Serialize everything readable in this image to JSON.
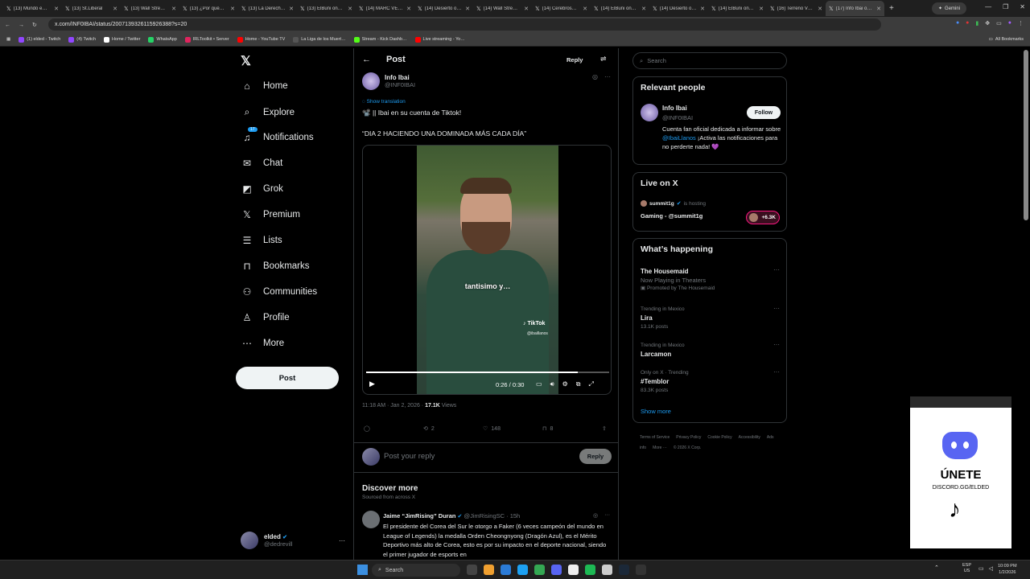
{
  "browser": {
    "tabs": [
      {
        "label": "(13) Mundo e…",
        "icon": "x-icon"
      },
      {
        "label": "(13) St.Liberal",
        "icon": "x-icon"
      },
      {
        "label": "(13) Wall Stre…",
        "icon": "x-icon"
      },
      {
        "label": "(13) ¿Por qué…",
        "icon": "x-icon"
      },
      {
        "label": "(13) La Derech…",
        "icon": "x-icon"
      },
      {
        "label": "(13) ElBuni on…",
        "icon": "x-icon"
      },
      {
        "label": "(14) MARC VE…",
        "icon": "x-icon"
      },
      {
        "label": "(14) Desierto o…",
        "icon": "x-icon"
      },
      {
        "label": "(14) Wall Stre…",
        "icon": "x-icon"
      },
      {
        "label": "(14) Cerebros…",
        "icon": "x-icon"
      },
      {
        "label": "(14) ElBuni on…",
        "icon": "x-icon"
      },
      {
        "label": "(14) Desierto o…",
        "icon": "x-icon"
      },
      {
        "label": "(14) ElBuni on…",
        "icon": "x-icon"
      },
      {
        "label": "(16) Terreno V…",
        "icon": "x-icon"
      },
      {
        "label": "(17) Info Ibai o…",
        "icon": "x-icon"
      }
    ],
    "new_tab": "+",
    "gemini": "Gemini",
    "url": "x.com/INF0IBAI/status/2007139326115926388?s=20",
    "bookmarks": [
      {
        "label": "(1) elded - Twitch",
        "color": "#9146ff"
      },
      {
        "label": "(4) Twitch",
        "color": "#9146ff"
      },
      {
        "label": "Home / Twitter",
        "color": "#ffffff"
      },
      {
        "label": "WhatsApp",
        "color": "#25d366"
      },
      {
        "label": "IRLToolkit • Server",
        "color": "#e0245e"
      },
      {
        "label": "Home - YouTube TV",
        "color": "#ff0000"
      },
      {
        "label": "La Liga de los Muert…",
        "color": "#555555"
      },
      {
        "label": "Stream - Kick Dashb…",
        "color": "#53fc18"
      },
      {
        "label": "Live streaming - Yo…",
        "color": "#ff0000"
      }
    ],
    "all_bookmarks": "All Bookmarks"
  },
  "nav": {
    "items": [
      {
        "label": "Home",
        "icon": "home-icon",
        "glyph": "⌂"
      },
      {
        "label": "Explore",
        "icon": "search-icon",
        "glyph": "⌕"
      },
      {
        "label": "Notifications",
        "icon": "bell-icon",
        "glyph": "♫"
      },
      {
        "label": "Chat",
        "icon": "envelope-icon",
        "glyph": "✉"
      },
      {
        "label": "Grok",
        "icon": "grok-icon",
        "glyph": "◩"
      },
      {
        "label": "Premium",
        "icon": "x-premium-icon",
        "glyph": "𝕏"
      },
      {
        "label": "Lists",
        "icon": "list-icon",
        "glyph": "☰"
      },
      {
        "label": "Bookmarks",
        "icon": "bookmark-icon",
        "glyph": "⊓"
      },
      {
        "label": "Communities",
        "icon": "communities-icon",
        "glyph": "⚇"
      },
      {
        "label": "Profile",
        "icon": "person-icon",
        "glyph": "♙"
      },
      {
        "label": "More",
        "icon": "more-circle-icon",
        "glyph": "⋯"
      }
    ],
    "notif_count": "17",
    "post_button": "Post",
    "user": {
      "name": "elded",
      "handle": "@dedrevill"
    }
  },
  "post": {
    "header_title": "Post",
    "header_reply": "Reply",
    "author_name": "Info Ibai",
    "author_handle": "@INF0IBAI",
    "show_translation": "Show translation",
    "line1": "📽️ || Ibai en su cuenta de Tiktok!",
    "line2": "“DIA 2 HACIENDO UNA DOMINADA MÁS CADA DÍA”",
    "video": {
      "caption": "tantisimo y…",
      "watermark": "TikTok",
      "watermark_handle": "@ibaillanos",
      "time": "0:26 / 0:30",
      "progress": 0.87
    },
    "timestamp": "11:18 AM · Jan 2, 2026 · ",
    "views_count": "17.1K",
    "views_label": " Views",
    "actions": {
      "reposts": "2",
      "likes": "148",
      "bookmarks": "8"
    },
    "reply_placeholder": "Post your reply",
    "reply_button": "Reply"
  },
  "discover": {
    "title": "Discover more",
    "subtitle": "Sourced from across X",
    "post": {
      "name": "Jaime “JimRising” Duran",
      "handle": "@JimRisingSC · 15h",
      "text": "El presidente del Corea del Sur le otorgo a Faker (6 veces campeón del mundo en League of Legends) la medalla Orden Cheongnyong (Dragón Azul), es el Mérito Deportivo más alto de Corea, esto es por su impacto en el deporte nacional, siendo el primer jugador de esports en"
    }
  },
  "right": {
    "search_placeholder": "Search",
    "relevant": {
      "title": "Relevant people",
      "name": "Info Ibai",
      "handle": "@INF0IBAI",
      "follow": "Follow",
      "bio_1": "Cuenta fan oficial dedicada a informar sobre ",
      "bio_link": "@IbaiLlanos",
      "bio_2": " ¡Activa las notificaciones para no perderte nada! 💜"
    },
    "live": {
      "title": "Live on X",
      "host": "summit1g",
      "hosting": "is hosting",
      "stream": "Gaming - @summit1g",
      "count": "+6.3K"
    },
    "happening": {
      "title": "What’s happening",
      "trends": [
        {
          "name": "The Housemaid",
          "sub": "Now Playing in Theaters",
          "promo": "Promoted by The Housemaid"
        },
        {
          "context": "Trending in Mexico",
          "name": "Lira",
          "posts": "13.1K posts"
        },
        {
          "context": "Trending in Mexico",
          "name": "Larcamon",
          "posts": ""
        },
        {
          "context": "Only on X · Trending",
          "name": "#Temblor",
          "posts": "83.3K posts"
        }
      ],
      "show_more": "Show more"
    },
    "footer": [
      "Terms of Service",
      "Privacy Policy",
      "Cookie Policy",
      "Accessibility",
      "Ads info",
      "More ···",
      "© 2026 X Corp."
    ]
  },
  "overlay": {
    "cta": "ÚNETE",
    "link": "DISCORD.GG/ELDED"
  },
  "taskbar": {
    "search": "Search",
    "lang_1": "ESP",
    "lang_2": "US",
    "time": "10:09 PM",
    "date": "1/2/2026"
  }
}
